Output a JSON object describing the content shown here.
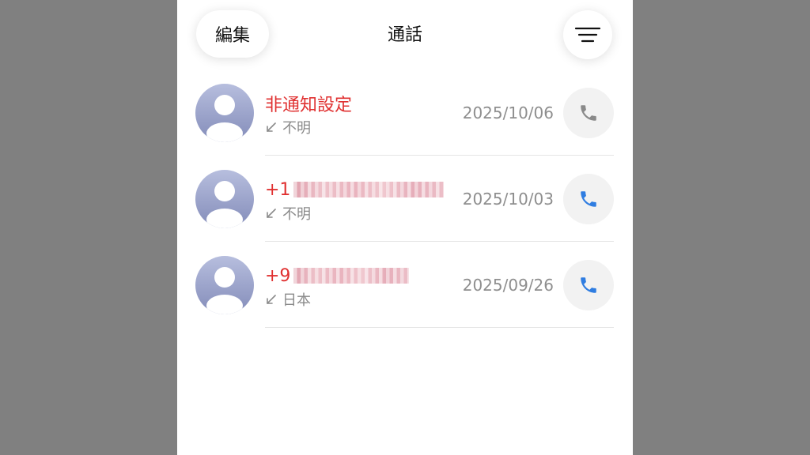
{
  "header": {
    "edit_label": "編集",
    "title": "通話",
    "filter_icon": "hamburger-menu-icon"
  },
  "colors": {
    "missed_call_red": "#e03131",
    "call_blue": "#2f7de1",
    "call_gray": "#8a8a8a",
    "secondary_text": "#8e8e8e"
  },
  "calls": [
    {
      "name_prefix": "非通知設定",
      "name_redacted": false,
      "direction_icon": "incoming-arrow-icon",
      "location": "不明",
      "date": "2025/10/06",
      "call_icon": "phone-icon",
      "call_icon_color": "#8a8a8a"
    },
    {
      "name_prefix": "+1",
      "name_redacted": true,
      "direction_icon": "incoming-arrow-icon",
      "location": "不明",
      "date": "2025/10/03",
      "call_icon": "phone-icon",
      "call_icon_color": "#2f7de1"
    },
    {
      "name_prefix": "+9",
      "name_redacted": true,
      "direction_icon": "incoming-arrow-icon",
      "location": "日本",
      "date": "2025/09/26",
      "call_icon": "phone-icon",
      "call_icon_color": "#2f7de1"
    }
  ]
}
